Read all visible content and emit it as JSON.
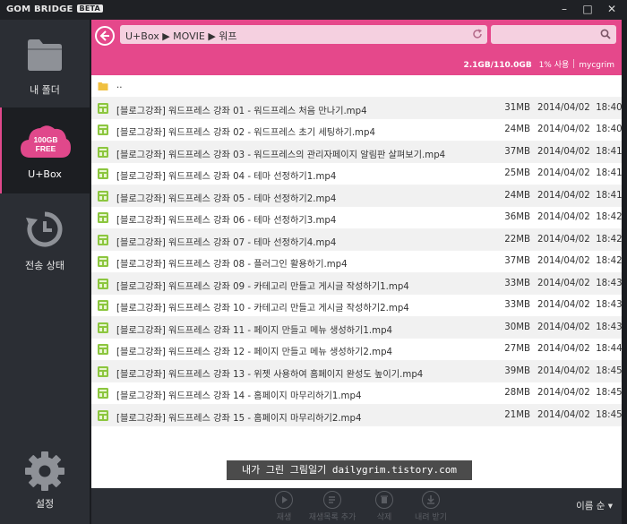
{
  "app": {
    "title": "GOM BRIDGE",
    "badge": "BETA"
  },
  "window_controls": [
    "–",
    "□",
    "✕"
  ],
  "sidebar": {
    "items": [
      {
        "label": "내 폴더",
        "icon": "folder-icon"
      },
      {
        "label": "U+Box",
        "icon": "cloud-icon",
        "badge": [
          "100GB",
          "FREE"
        ],
        "active": true
      },
      {
        "label": "전송 상태",
        "icon": "history-icon"
      },
      {
        "label": "설정",
        "icon": "gear-icon"
      }
    ]
  },
  "address": {
    "path": "U+Box ▶ MOVIE ▶ 워프"
  },
  "storage": {
    "usage": "2.1GB/110.0GB",
    "percent": "1% 사용",
    "user": "mycgrim"
  },
  "parent_dir": "..",
  "files": [
    {
      "name": "[블로그강좌] 워드프레스 강좌 01 - 워드프레스 처음 만나기.mp4",
      "size": "31MB",
      "date": "2014/04/02",
      "time": "18:40"
    },
    {
      "name": "[블로그강좌] 워드프레스 강좌 02 - 워드프레스 초기 세팅하기.mp4",
      "size": "24MB",
      "date": "2014/04/02",
      "time": "18:40"
    },
    {
      "name": "[블로그강좌] 워드프레스 강좌 03 - 워드프레스의 관리자페이지 알림판 살펴보기.mp4",
      "size": "37MB",
      "date": "2014/04/02",
      "time": "18:41"
    },
    {
      "name": "[블로그강좌] 워드프레스 강좌 04 - 테마 선정하기1.mp4",
      "size": "25MB",
      "date": "2014/04/02",
      "time": "18:41"
    },
    {
      "name": "[블로그강좌] 워드프레스 강좌 05 - 테마 선정하기2.mp4",
      "size": "24MB",
      "date": "2014/04/02",
      "time": "18:41"
    },
    {
      "name": "[블로그강좌] 워드프레스 강좌 06 - 테마 선정하기3.mp4",
      "size": "36MB",
      "date": "2014/04/02",
      "time": "18:42"
    },
    {
      "name": "[블로그강좌] 워드프레스 강좌 07 - 테마 선정하기4.mp4",
      "size": "22MB",
      "date": "2014/04/02",
      "time": "18:42"
    },
    {
      "name": "[블로그강좌] 워드프레스 강좌 08 - 플러그인 활용하기.mp4",
      "size": "37MB",
      "date": "2014/04/02",
      "time": "18:42"
    },
    {
      "name": "[블로그강좌] 워드프레스 강좌 09 - 카테고리 만들고 게시글 작성하기1.mp4",
      "size": "33MB",
      "date": "2014/04/02",
      "time": "18:43"
    },
    {
      "name": "[블로그강좌] 워드프레스 강좌 10 - 카테고리 만들고 게시글 작성하기2.mp4",
      "size": "33MB",
      "date": "2014/04/02",
      "time": "18:43"
    },
    {
      "name": "[블로그강좌] 워드프레스 강좌 11 - 페이지 만들고 메뉴 생성하기1.mp4",
      "size": "30MB",
      "date": "2014/04/02",
      "time": "18:43"
    },
    {
      "name": "[블로그강좌] 워드프레스 강좌 12 - 페이지 만들고 메뉴 생성하기2.mp4",
      "size": "27MB",
      "date": "2014/04/02",
      "time": "18:44"
    },
    {
      "name": "[블로그강좌] 워드프레스 강좌 13 - 위젯 사용하여 홈페이지 완성도 높이기.mp4",
      "size": "39MB",
      "date": "2014/04/02",
      "time": "18:45"
    },
    {
      "name": "[블로그강좌] 워드프레스 강좌 14 - 홈페이지 마무리하기1.mp4",
      "size": "28MB",
      "date": "2014/04/02",
      "time": "18:45"
    },
    {
      "name": "[블로그강좌] 워드프레스 강좌 15 - 홈페이지 마무리하기2.mp4",
      "size": "21MB",
      "date": "2014/04/02",
      "time": "18:45"
    }
  ],
  "toolbar": {
    "play": "재생",
    "playlist": "재생목록 추가",
    "delete": "삭제",
    "download": "내려 받기",
    "sort": "이름 순 ▾"
  },
  "watermark": "내가 그린 그림일기 dailygrim.tistory.com",
  "colors": {
    "accent": "#e5488b",
    "sidebar": "#2b2e34",
    "file_icon": "#8cc63f"
  }
}
